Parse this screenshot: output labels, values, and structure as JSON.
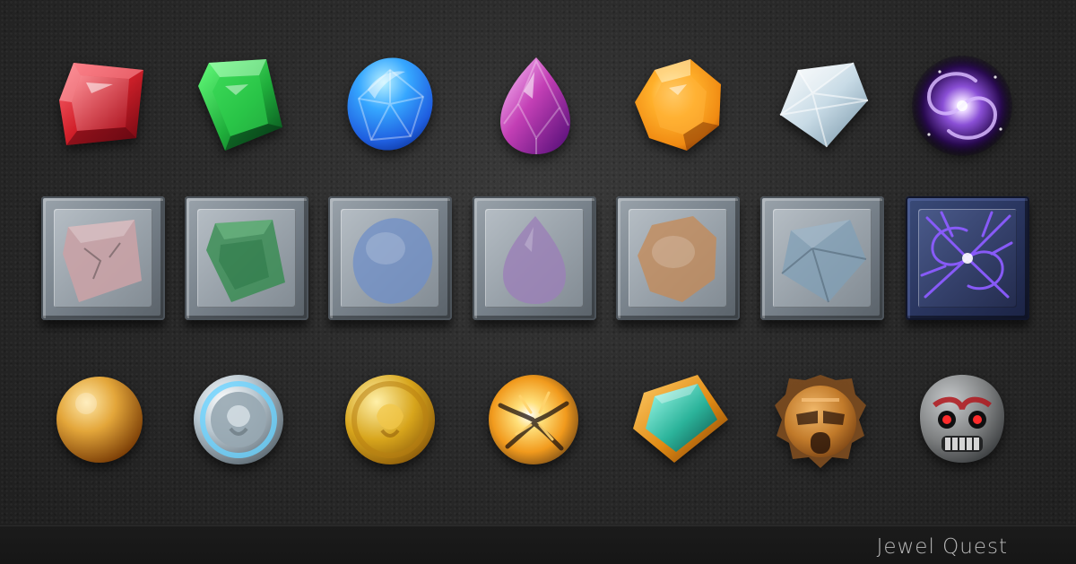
{
  "footer": {
    "title": "Jewel Quest"
  },
  "rows": {
    "gems": [
      {
        "name": "ruby",
        "icon": "red-gem-icon",
        "color": "#d1202a"
      },
      {
        "name": "emerald",
        "icon": "green-gem-icon",
        "color": "#1fae3b"
      },
      {
        "name": "sapphire",
        "icon": "blue-gem-icon",
        "color": "#1f79e3"
      },
      {
        "name": "amethyst",
        "icon": "purple-gem-icon",
        "color": "#c33fb5"
      },
      {
        "name": "topaz",
        "icon": "orange-gem-icon",
        "color": "#f08a12"
      },
      {
        "name": "diamond",
        "icon": "diamond-icon",
        "color": "#c8dbe6"
      },
      {
        "name": "vortex",
        "icon": "purple-vortex-icon",
        "color": "#8a4fd6"
      }
    ],
    "stone_tiles": [
      {
        "icon": "stone-red-gem-slot-icon",
        "color": "#c9a2a6"
      },
      {
        "icon": "stone-green-gem-slot-icon",
        "color": "#2f8b4a"
      },
      {
        "icon": "stone-blue-gem-slot-icon",
        "color": "#6f8fc8"
      },
      {
        "icon": "stone-purple-gem-slot-icon",
        "color": "#9b7fb8"
      },
      {
        "icon": "stone-orange-gem-slot-icon",
        "color": "#c58a56"
      },
      {
        "icon": "stone-diamond-slot-icon",
        "color": "#7fa0b8"
      },
      {
        "icon": "cracked-vortex-stone-icon",
        "color": "#8c5cff"
      }
    ],
    "specials": [
      {
        "name": "gold-orb",
        "icon": "gold-orb-icon",
        "color": "#e3a63a"
      },
      {
        "name": "silver-lion-coin",
        "icon": "silver-lion-coin-icon",
        "color": "#b8c6cf"
      },
      {
        "name": "gold-lion-coin",
        "icon": "gold-lion-coin-icon",
        "color": "#d7a51c"
      },
      {
        "name": "fire-orb",
        "icon": "fire-orb-icon",
        "color": "#f19a1d"
      },
      {
        "name": "teal-gem-amber-frame",
        "icon": "teal-gem-framed-icon",
        "color": "#2bb39a"
      },
      {
        "name": "tribal-mask",
        "icon": "tribal-mask-icon",
        "color": "#c17a2a"
      },
      {
        "name": "monkey-skull",
        "icon": "monkey-skull-icon",
        "color": "#7d7f80"
      }
    ]
  }
}
